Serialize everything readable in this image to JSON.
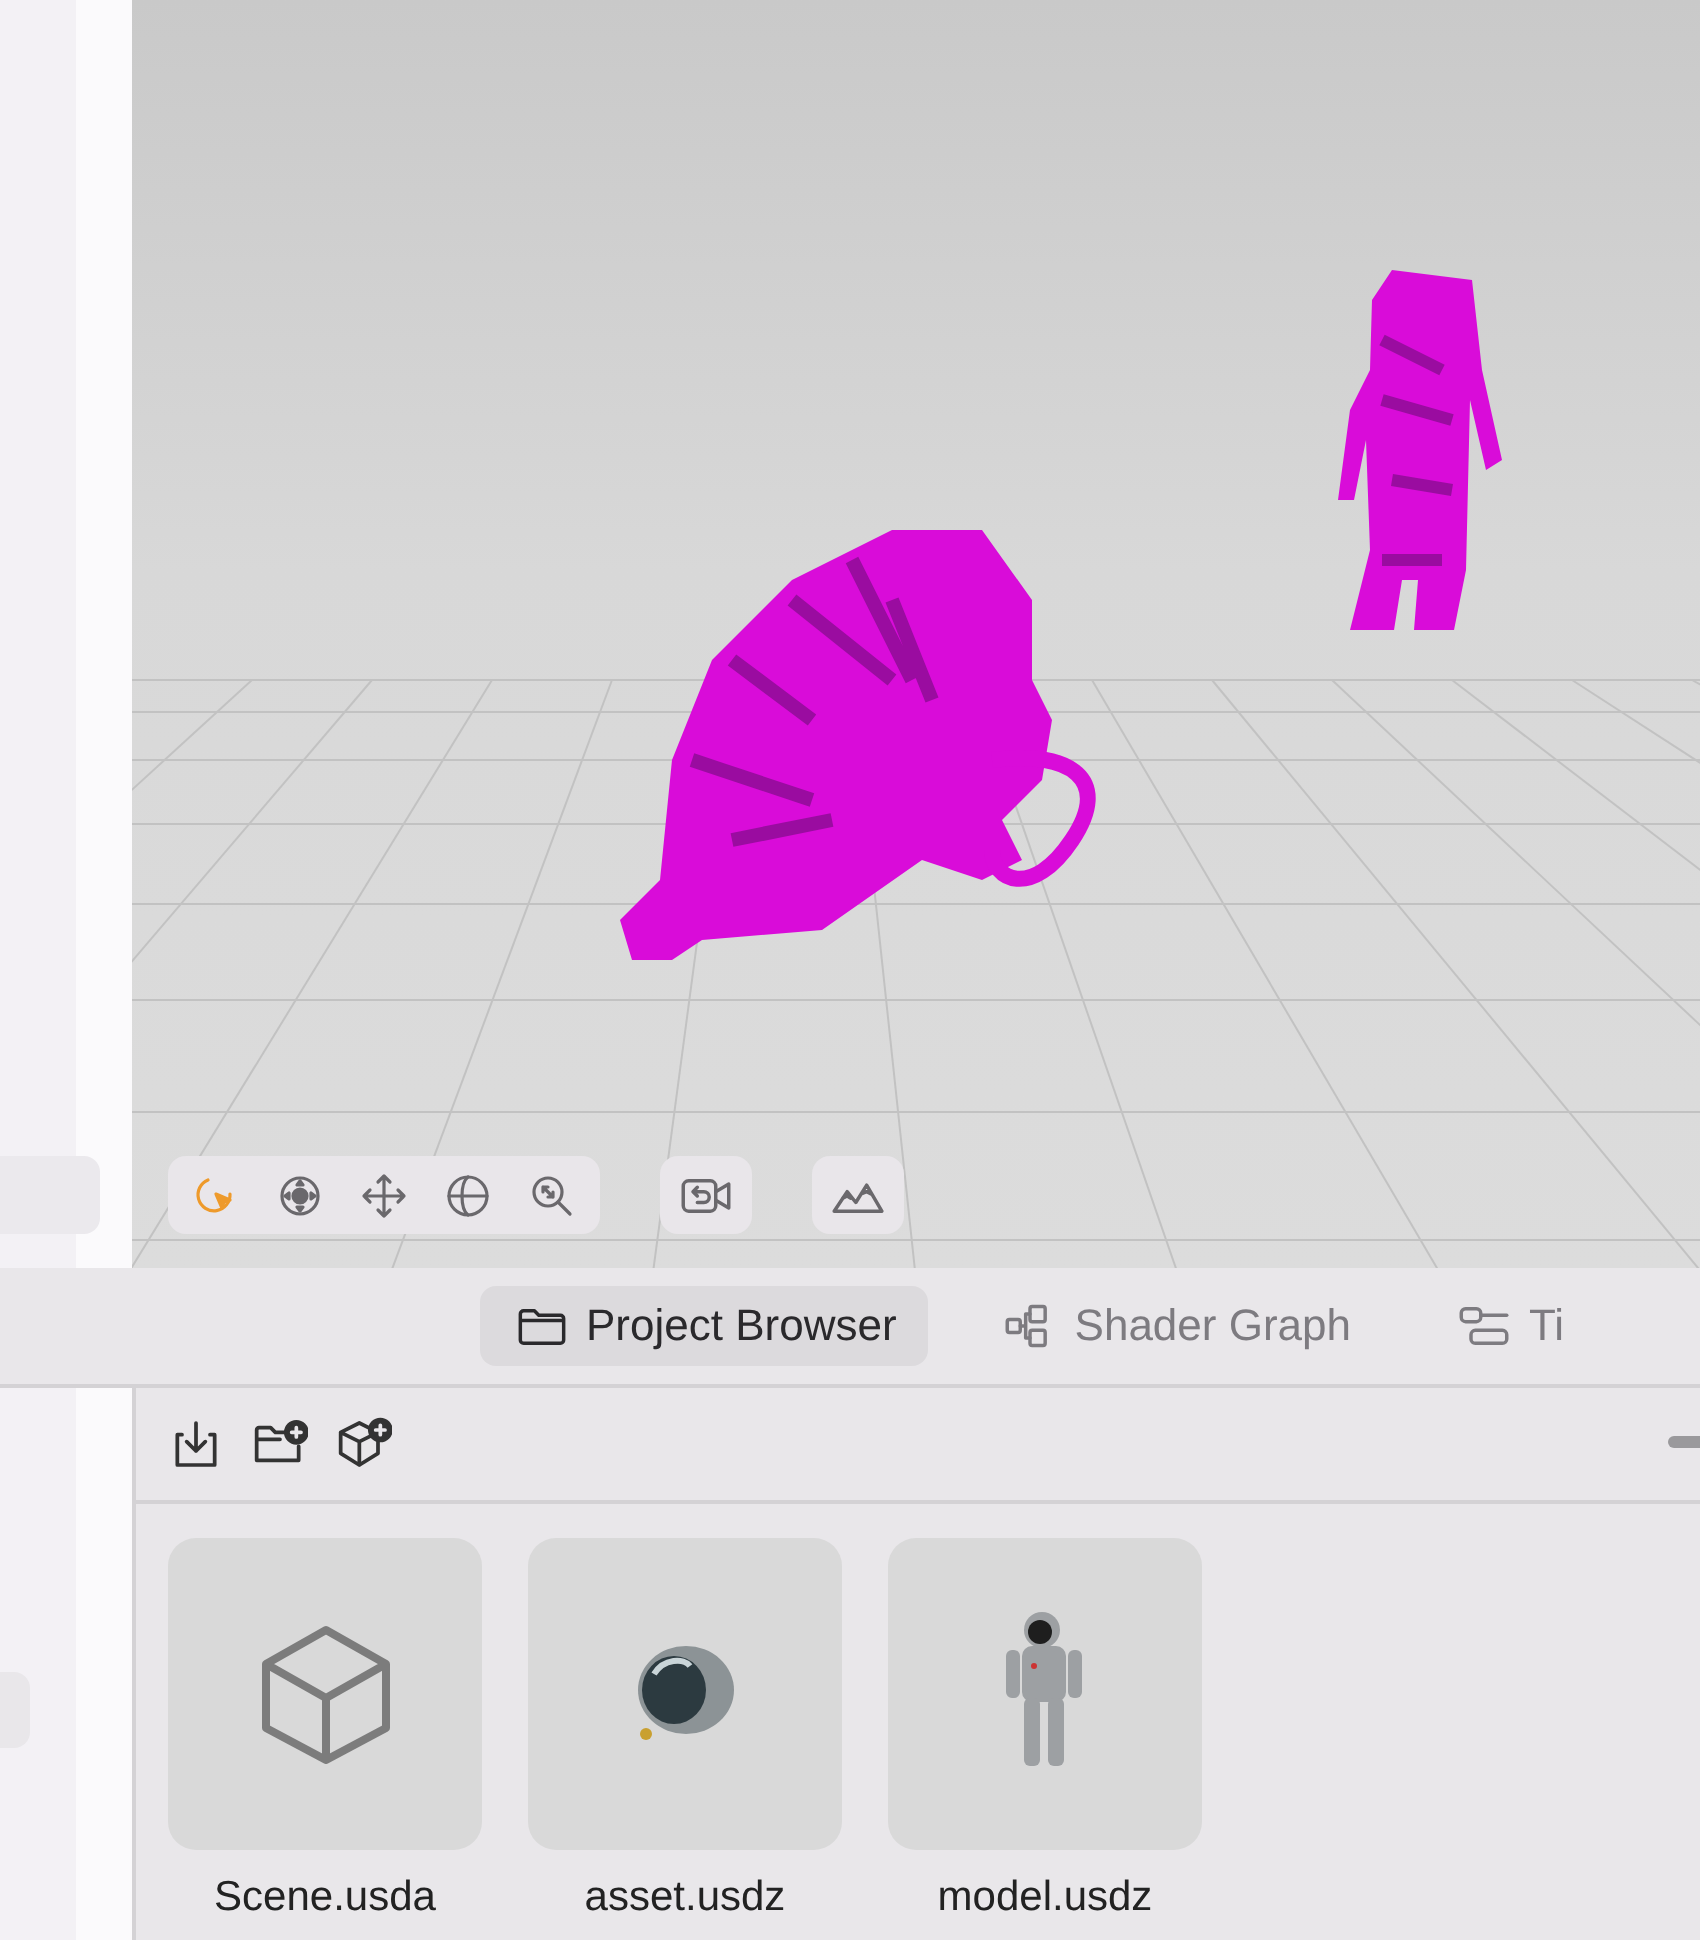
{
  "viewport": {
    "tools": [
      {
        "kind": "select",
        "selected": true
      },
      {
        "kind": "orbit",
        "selected": false
      },
      {
        "kind": "move",
        "selected": false
      },
      {
        "kind": "rotate",
        "selected": false
      },
      {
        "kind": "zoom",
        "selected": false
      }
    ],
    "buttons": [
      {
        "kind": "camera"
      },
      {
        "kind": "environment"
      }
    ]
  },
  "tabs": [
    {
      "label": "Project Browser",
      "kind": "folder",
      "selected": true
    },
    {
      "label": "Shader Graph",
      "kind": "graph",
      "selected": false
    },
    {
      "label": "Ti",
      "kind": "timeline",
      "selected": false
    }
  ],
  "browser": {
    "actions": [
      {
        "kind": "import"
      },
      {
        "kind": "new-folder"
      },
      {
        "kind": "add-object"
      }
    ],
    "assets": [
      {
        "name": "Scene.usda",
        "kind": "scene"
      },
      {
        "name": "asset.usdz",
        "kind": "helmet"
      },
      {
        "name": "model.usdz",
        "kind": "astronaut"
      }
    ]
  }
}
